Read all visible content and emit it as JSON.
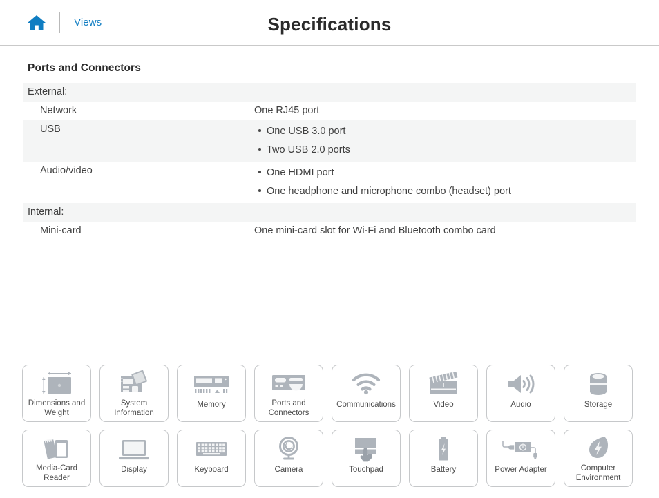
{
  "header": {
    "home_icon": "home-icon",
    "views_label": "Views",
    "title": "Specifications"
  },
  "section": {
    "title": "Ports and Connectors",
    "groups": [
      {
        "label": "External:",
        "rows": [
          {
            "key": "Network",
            "type": "plain",
            "value": "One RJ45 port"
          },
          {
            "key": "USB",
            "type": "list",
            "items": [
              "One USB 3.0 port",
              "Two USB 2.0 ports"
            ]
          },
          {
            "key": "Audio/video",
            "type": "list",
            "items": [
              "One HDMI port",
              "One headphone and microphone combo (headset) port"
            ]
          }
        ]
      },
      {
        "label": "Internal:",
        "rows": [
          {
            "key": "Mini-card",
            "type": "plain",
            "value": "One mini-card slot for Wi-Fi and Bluetooth combo card"
          }
        ]
      }
    ]
  },
  "tiles": [
    {
      "label": "Dimensions and Weight",
      "icon": "dimensions-icon"
    },
    {
      "label": "System Information",
      "icon": "system-information-icon"
    },
    {
      "label": "Memory",
      "icon": "memory-icon"
    },
    {
      "label": "Ports and Connectors",
      "icon": "ports-connectors-icon"
    },
    {
      "label": "Communications",
      "icon": "wifi-icon"
    },
    {
      "label": "Video",
      "icon": "clapperboard-icon"
    },
    {
      "label": "Audio",
      "icon": "speaker-icon"
    },
    {
      "label": "Storage",
      "icon": "storage-icon"
    },
    {
      "label": "Media-Card Reader",
      "icon": "media-card-reader-icon"
    },
    {
      "label": "Display",
      "icon": "display-icon"
    },
    {
      "label": "Keyboard",
      "icon": "keyboard-icon"
    },
    {
      "label": "Camera",
      "icon": "camera-icon"
    },
    {
      "label": "Touchpad",
      "icon": "touchpad-icon"
    },
    {
      "label": "Battery",
      "icon": "battery-icon"
    },
    {
      "label": "Power Adapter",
      "icon": "power-adapter-icon"
    },
    {
      "label": "Computer Environment",
      "icon": "leaf-icon"
    }
  ],
  "colors": {
    "link": "#0f7dc2",
    "home": "#0f7dc2",
    "row_shade": "#f4f5f5",
    "icon_gray": "#aeb4bb",
    "tile_border": "#c6c8ca"
  }
}
